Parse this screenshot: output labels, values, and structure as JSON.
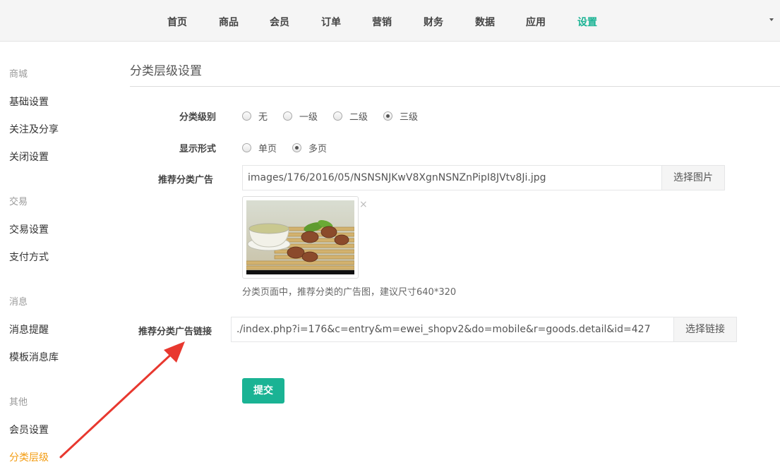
{
  "nav": {
    "items": [
      {
        "label": "首页"
      },
      {
        "label": "商品"
      },
      {
        "label": "会员"
      },
      {
        "label": "订单"
      },
      {
        "label": "营销"
      },
      {
        "label": "财务"
      },
      {
        "label": "数据"
      },
      {
        "label": "应用"
      },
      {
        "label": "设置",
        "active": true
      }
    ]
  },
  "sidebar": {
    "groups": [
      {
        "title": "商城",
        "items": [
          "基础设置",
          "关注及分享",
          "关闭设置"
        ]
      },
      {
        "title": "交易",
        "items": [
          "交易设置",
          "支付方式"
        ]
      },
      {
        "title": "消息",
        "items": [
          "消息提醒",
          "模板消息库"
        ]
      },
      {
        "title": "其他",
        "items": [
          "会员设置",
          "分类层级"
        ]
      }
    ],
    "active_item": "分类层级"
  },
  "page": {
    "title": "分类层级设置"
  },
  "form": {
    "level": {
      "label": "分类级别",
      "options": [
        "无",
        "一级",
        "二级",
        "三级"
      ],
      "selected": "三级"
    },
    "display": {
      "label": "显示形式",
      "options": [
        "单页",
        "多页"
      ],
      "selected": "多页"
    },
    "ad_image": {
      "label": "推荐分类广告",
      "value": "images/176/2016/05/NSNSNJKwV8XgnNSNZnPipI8JVtv8Ji.jpg",
      "button": "选择图片",
      "help": "分类页面中，推荐分类的广告图，建议尺寸640*320",
      "remove_symbol": "×"
    },
    "ad_link": {
      "label": "推荐分类广告链接",
      "value": "./index.php?i=176&c=entry&m=ewei_shopv2&do=mobile&r=goods.detail&id=427",
      "button": "选择链接"
    },
    "submit": "提交"
  },
  "colors": {
    "accent": "#1ab394",
    "active_sidebar": "#f39c12",
    "annotation_arrow": "#e8382f"
  }
}
